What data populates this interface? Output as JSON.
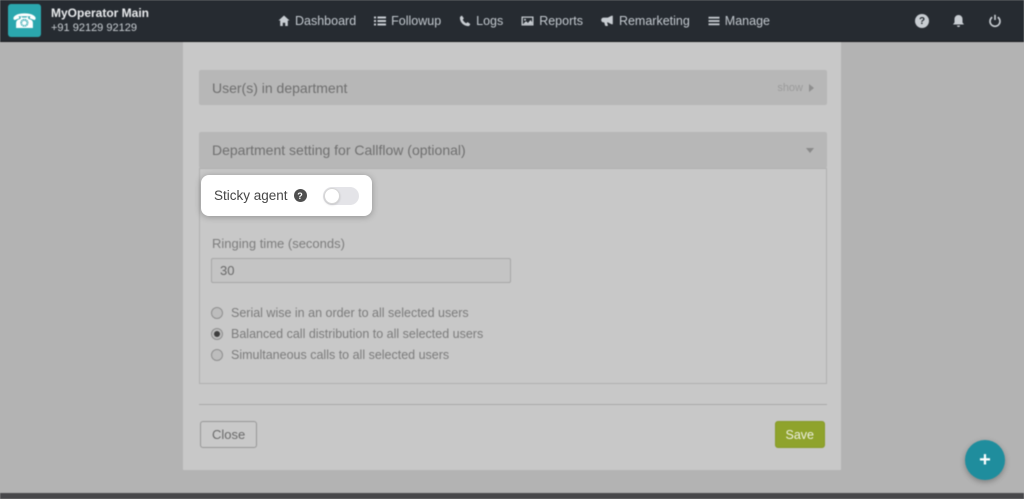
{
  "navbar": {
    "brand": {
      "title": "MyOperator Main",
      "subtitle": "+91 92129 92129"
    },
    "items": [
      {
        "label": "Dashboard",
        "icon": "home-icon"
      },
      {
        "label": "Followup",
        "icon": "list-icon"
      },
      {
        "label": "Logs",
        "icon": "phone-handset-icon"
      },
      {
        "label": "Reports",
        "icon": "reports-image-icon"
      },
      {
        "label": "Remarketing",
        "icon": "megaphone-icon"
      },
      {
        "label": "Manage",
        "icon": "bars-icon"
      }
    ],
    "right_icons": [
      "help-icon",
      "bell-icon",
      "power-icon"
    ]
  },
  "form": {
    "users_section": {
      "title": "User(s) in department",
      "action_label": "show"
    },
    "department_section": {
      "title": "Department setting for Callflow (optional)"
    },
    "sticky_agent": {
      "label": "Sticky agent",
      "toggle_state": "off"
    },
    "ringing_time": {
      "label": "Ringing time (seconds)",
      "value": "30"
    },
    "distribution_options": [
      {
        "label": "Serial wise in an order to all selected users",
        "selected": false
      },
      {
        "label": "Balanced call distribution to all selected users",
        "selected": true
      },
      {
        "label": "Simultaneous calls to all selected users",
        "selected": false
      }
    ],
    "close_label": "Close",
    "save_label": "Save"
  },
  "glyphs": {
    "logo_phone": "☎",
    "question_mark": "?",
    "plus": "+"
  },
  "colors": {
    "navbar_background": "#262b31",
    "logo_background": "#2ba7ae",
    "page_background": "#b3b3b3",
    "panel_background": "#c8c8c8",
    "section_header_background": "#b7b7b7",
    "save_button": "#8fa32c",
    "fab": "#1f8d9d",
    "spotlight": "#ffffff"
  }
}
